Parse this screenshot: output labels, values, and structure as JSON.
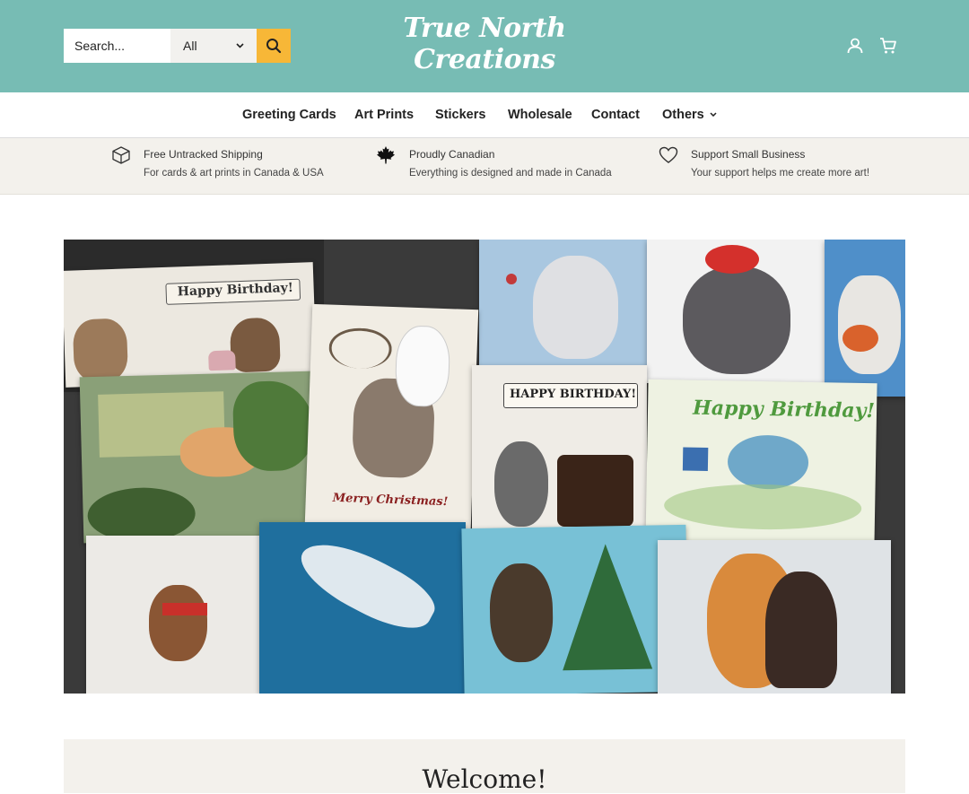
{
  "header": {
    "search_placeholder": "Search...",
    "search_category": "All",
    "logo_line1": "True North",
    "logo_line2": "Creations",
    "colors": {
      "header_bg": "#77bcb4",
      "search_button": "#f7b737"
    }
  },
  "nav": {
    "items": [
      {
        "label": "Greeting Cards"
      },
      {
        "label": "Art Prints"
      },
      {
        "label": "Stickers"
      },
      {
        "label": "Wholesale"
      },
      {
        "label": "Contact"
      },
      {
        "label": "Others"
      }
    ]
  },
  "features": [
    {
      "icon": "box-icon",
      "title": "Free Untracked Shipping",
      "subtitle": "For cards & art prints in Canada & USA"
    },
    {
      "icon": "maple-leaf-icon",
      "title": "Proudly Canadian",
      "subtitle": "Everything is designed and made in Canada"
    },
    {
      "icon": "heart-icon",
      "title": "Support Small Business",
      "subtitle": "Your support helps me create more art!"
    }
  ],
  "hero": {
    "card_texts": {
      "happy_birthday_1": "Happy Birthday!",
      "happy_birthday_2": "HAPPY BIRTHDAY!",
      "happy_birthday_3": "Happy Birthday!",
      "merry_christmas": "Merry Christmas!"
    }
  },
  "welcome": {
    "title": "Welcome!"
  }
}
